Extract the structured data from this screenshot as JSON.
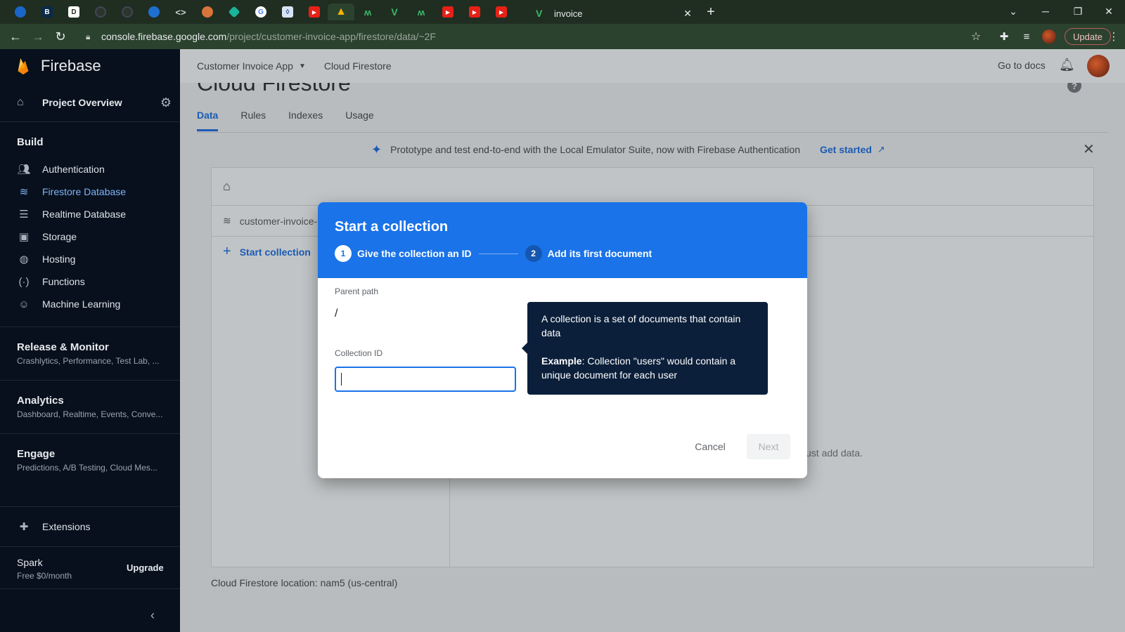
{
  "browser": {
    "active_tab_title": "invoice",
    "url_host": "console.firebase.google.com",
    "url_path": "/project/customer-invoice-app/firestore/data/~2F",
    "update_label": "Update"
  },
  "sidebar": {
    "brand": "Firebase",
    "overview": "Project Overview",
    "build_heading": "Build",
    "build_items": [
      {
        "label": "Authentication",
        "icon": "people-icon"
      },
      {
        "label": "Firestore Database",
        "icon": "firestore-icon"
      },
      {
        "label": "Realtime Database",
        "icon": "database-icon"
      },
      {
        "label": "Storage",
        "icon": "image-icon"
      },
      {
        "label": "Hosting",
        "icon": "globe-icon"
      },
      {
        "label": "Functions",
        "icon": "functions-icon"
      },
      {
        "label": "Machine Learning",
        "icon": "robot-icon"
      }
    ],
    "groups": [
      {
        "title": "Release & Monitor",
        "sub": "Crashlytics, Performance, Test Lab, ..."
      },
      {
        "title": "Analytics",
        "sub": "Dashboard, Realtime, Events, Conve..."
      },
      {
        "title": "Engage",
        "sub": "Predictions, A/B Testing, Cloud Mes..."
      }
    ],
    "extensions": "Extensions",
    "plan_name": "Spark",
    "plan_price": "Free $0/month",
    "upgrade": "Upgrade"
  },
  "appbar": {
    "project": "Customer Invoice App",
    "crumb": "Cloud Firestore",
    "docs": "Go to docs"
  },
  "page": {
    "title": "Cloud Firestore",
    "tabs": [
      "Data",
      "Rules",
      "Indexes",
      "Usage"
    ],
    "banner_text": "Prototype and test end-to-end with the Local Emulator Suite, now with Firebase Authentication",
    "banner_link": "Get started",
    "collection_crumb": "customer-invoice-",
    "start_collection": "Start collection",
    "empty_hint": "Just add data.",
    "location": "Cloud Firestore location: nam5 (us-central)"
  },
  "modal": {
    "title": "Start a collection",
    "step1_num": "1",
    "step1_label": "Give the collection an ID",
    "step2_num": "2",
    "step2_label": "Add its first document",
    "parent_path_label": "Parent path",
    "parent_path_value": "/",
    "collection_id_label": "Collection ID",
    "collection_id_value": "",
    "tooltip_line1": "A collection is a set of documents that contain data",
    "tooltip_example_bold": "Example",
    "tooltip_example_rest": ": Collection \"users\" would contain a unique document for each user",
    "cancel": "Cancel",
    "next": "Next"
  }
}
